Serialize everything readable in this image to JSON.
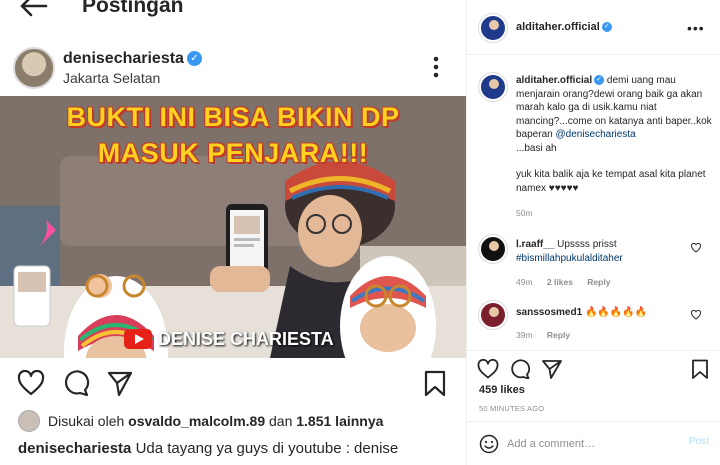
{
  "mobile": {
    "title": "Postingan",
    "post": {
      "username": "denisechariesta",
      "location": "Jakarta Selatan",
      "image": {
        "headline_line1": "BUKTI INI BISA BIKIN DP",
        "headline_line2": "MASUK PENJARA!!!",
        "channel_name": "DENISE CHARIESTA"
      },
      "liked_by_prefix": "Disukai oleh",
      "liked_by_user": "osvaldo_malcolm.89",
      "liked_by_mid": "dan",
      "liked_by_others": "1.851 lainnya",
      "caption_user": "denisechariesta",
      "caption_text": "Uda tayang ya guys di youtube : denise"
    }
  },
  "desktop": {
    "header_user": "alditaher.official",
    "main_comment": {
      "user": "alditaher.official",
      "text_before_mention": "demi uang mau menjarain orang?dewi orang baik ga akan marah kalo ga di usik.kamu niat mancing?...come on katanya anti baper..kok baperan",
      "mention": "@denisechariesta",
      "text_after_mention": "...basi ah",
      "text2": "yuk kita balik aja ke tempat asal kita planet namex ♥♥♥♥♥",
      "time": "50m"
    },
    "comments": [
      {
        "user": "l.raaff__",
        "text": "Upssss prisst",
        "hashtag": "#bismillahpukulalditaher",
        "time": "49m",
        "likes": "2 likes",
        "reply": "Reply"
      },
      {
        "user": "sanssosmed1",
        "text": "🔥🔥🔥🔥🔥",
        "time": "39m",
        "reply": "Reply"
      }
    ],
    "likes": "459 likes",
    "time_ago": "50 MINUTES AGO",
    "comment_placeholder": "Add a comment…",
    "post_label": "Post"
  },
  "colors": {
    "accent": "#3897f0",
    "headline_yellow": "#ffd21f",
    "headline_red": "#c0392b",
    "youtube_red": "#e62117",
    "mention_blue": "#00376b",
    "muted": "#8e8e8e"
  }
}
